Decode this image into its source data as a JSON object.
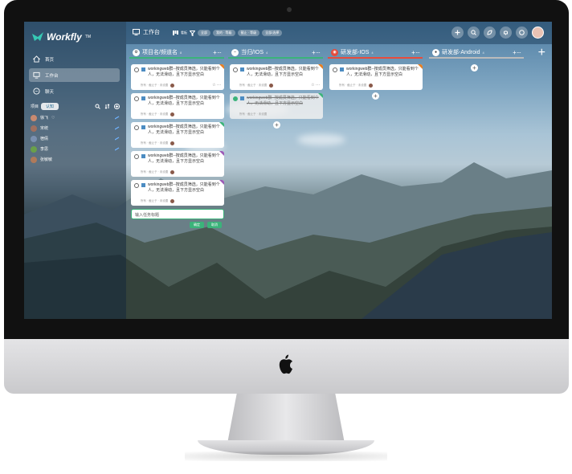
{
  "app": {
    "name": "Workfly",
    "trademark": "TM"
  },
  "sidebar": {
    "nav": [
      {
        "label": "首页",
        "icon": "home-icon"
      },
      {
        "label": "工作台",
        "icon": "monitor-icon",
        "active": true
      },
      {
        "label": "聊天",
        "icon": "chat-icon"
      }
    ],
    "project_label": "项目",
    "project_button": "认知",
    "members": [
      {
        "name": "徐飞",
        "color": "#c98a70",
        "heart": true
      },
      {
        "name": "宋统",
        "color": "#a07060"
      },
      {
        "name": "宿倩",
        "color": "#7a90b0"
      },
      {
        "name": "李思",
        "color": "#6aa04a"
      },
      {
        "name": "张敏敏",
        "color": "#b07a5a"
      }
    ]
  },
  "topbar": {
    "title": "工作台",
    "view_label": "看板",
    "filters": [
      "全部",
      "我的 · 等级",
      "截止 · 等级",
      "全部/选择"
    ]
  },
  "columns": [
    {
      "title": "项目名/频道名",
      "count": "8",
      "accent": "#3bb37a",
      "badge_color": "#ffffff"
    },
    {
      "title": "当归/IOS",
      "count": "4",
      "accent": "#3bb37a",
      "badge_color": "#ffffff"
    },
    {
      "title": "研发部-IOS",
      "count": "4",
      "accent": "#e74c3c",
      "badge_color": "#e74c3c"
    },
    {
      "title": "研发部-Android",
      "count": "4",
      "accent": "#bbbbbb",
      "badge_color": "#ffffff"
    }
  ],
  "cards": {
    "text": "workingweb群--按成员筛选，只能看到个人，无法滑动，且下方显示空白",
    "meta": "所有 · 截止于 · 未设置"
  },
  "new_task": {
    "placeholder": "输入任务标题",
    "confirm": "确定",
    "cancel": "取消"
  },
  "colors": {
    "accent": "#3bb37a",
    "danger": "#e74c3c",
    "purple": "#9b59b6",
    "orange": "#e67e22"
  }
}
